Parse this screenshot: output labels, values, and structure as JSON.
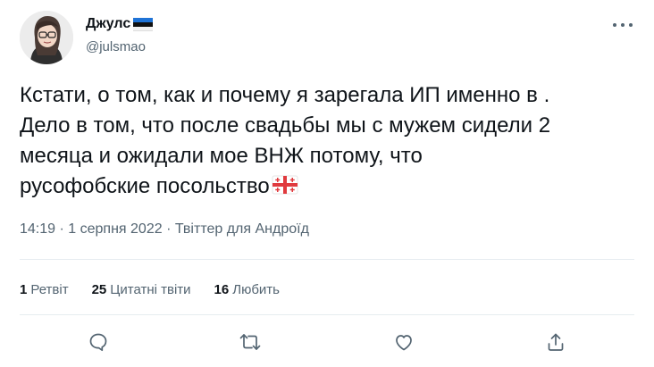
{
  "user": {
    "display_name": "Джулс",
    "handle": "@julsmao",
    "flag_icon": "estonia-flag-icon"
  },
  "tweet": {
    "lines": [
      "Кстати, о том, как и почему я зарегала ИП именно в .",
      "Дело в том, что после свадьбы мы с мужем сидели 2",
      "месяца и ожидали мое ВНЖ потому, что",
      "русофобские посольство"
    ],
    "emoji_icon": "georgia-flag-icon"
  },
  "meta": {
    "time": "14:19",
    "date": "1 серпня 2022",
    "source": "Твіттер для Андроїд"
  },
  "stats": {
    "retweets_count": "1",
    "retweets_label": "Ретвіт",
    "quotes_count": "25",
    "quotes_label": "Цитатні твіти",
    "likes_count": "16",
    "likes_label": "Любить"
  },
  "actions": [
    "reply-icon",
    "retweet-icon",
    "like-icon",
    "share-icon"
  ],
  "colors": {
    "text": "#0f1419",
    "secondary": "#536471",
    "divider": "#e6ecf0"
  }
}
